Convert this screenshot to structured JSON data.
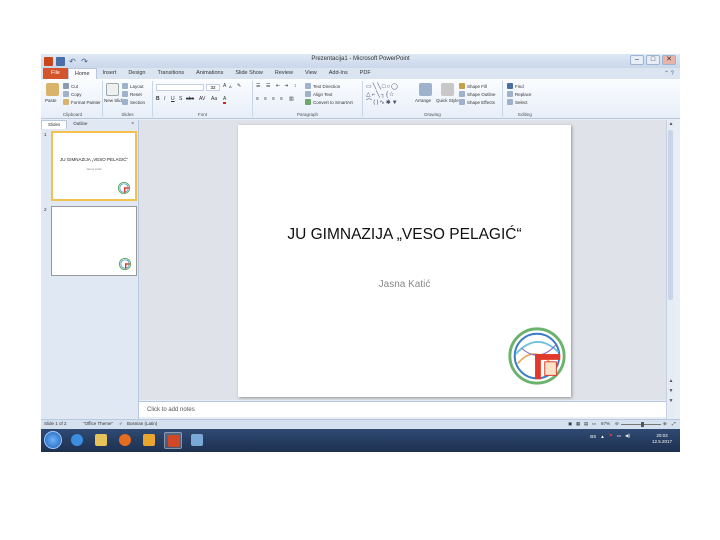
{
  "window": {
    "title": "Prezentacija1 - Microsoft PowerPoint"
  },
  "tabs": [
    "File",
    "Home",
    "Insert",
    "Design",
    "Transitions",
    "Animations",
    "Slide Show",
    "Review",
    "View",
    "Add-Ins",
    "PDF"
  ],
  "active_tab": "Home",
  "ribbon": {
    "clipboard": {
      "paste": "Paste",
      "cut": "Cut",
      "copy": "Copy",
      "format_painter": "Format Painter",
      "label": "Clipboard"
    },
    "slides": {
      "new_slide": "New Slide",
      "layout": "Layout",
      "reset": "Reset",
      "section": "Section",
      "label": "Slides"
    },
    "font": {
      "label": "Font",
      "size": "32"
    },
    "paragraph": {
      "text_direction": "Text Direction",
      "align_text": "Align Text",
      "convert_smartart": "Convert to SmartArt",
      "label": "Paragraph"
    },
    "drawing": {
      "arrange": "Arrange",
      "quick_styles": "Quick Styles",
      "shape_fill": "Shape Fill",
      "shape_outline": "Shape Outline",
      "shape_effects": "Shape Effects",
      "label": "Drawing"
    },
    "editing": {
      "find": "Find",
      "replace": "Replace",
      "select": "Select",
      "label": "Editing"
    }
  },
  "pane": {
    "tabs": [
      "Slides",
      "Outline"
    ],
    "close": "×"
  },
  "thumbnails": [
    {
      "number": "1",
      "title": "JU GIMNAZIJA „VESO PELAGIĆ“",
      "subtitle": "Jasna Katić"
    },
    {
      "number": "2"
    }
  ],
  "slide": {
    "title": "JU GIMNAZIJA „VESO PELAGIĆ“",
    "subtitle": "Jasna Katić"
  },
  "notes": {
    "placeholder": "Click to add notes"
  },
  "status": {
    "slide": "Slide 1 of 2",
    "theme": "\"Office Theme\"",
    "language": "Bosnian (Latin)",
    "zoom": "67%"
  },
  "clock": {
    "time": "20:03",
    "date": "12.5.2017"
  },
  "tray": {
    "language": "BS"
  },
  "colors": {
    "file_tab": "#d4552b",
    "taskbar": "#1d3050",
    "selection": "#f2c14e"
  }
}
